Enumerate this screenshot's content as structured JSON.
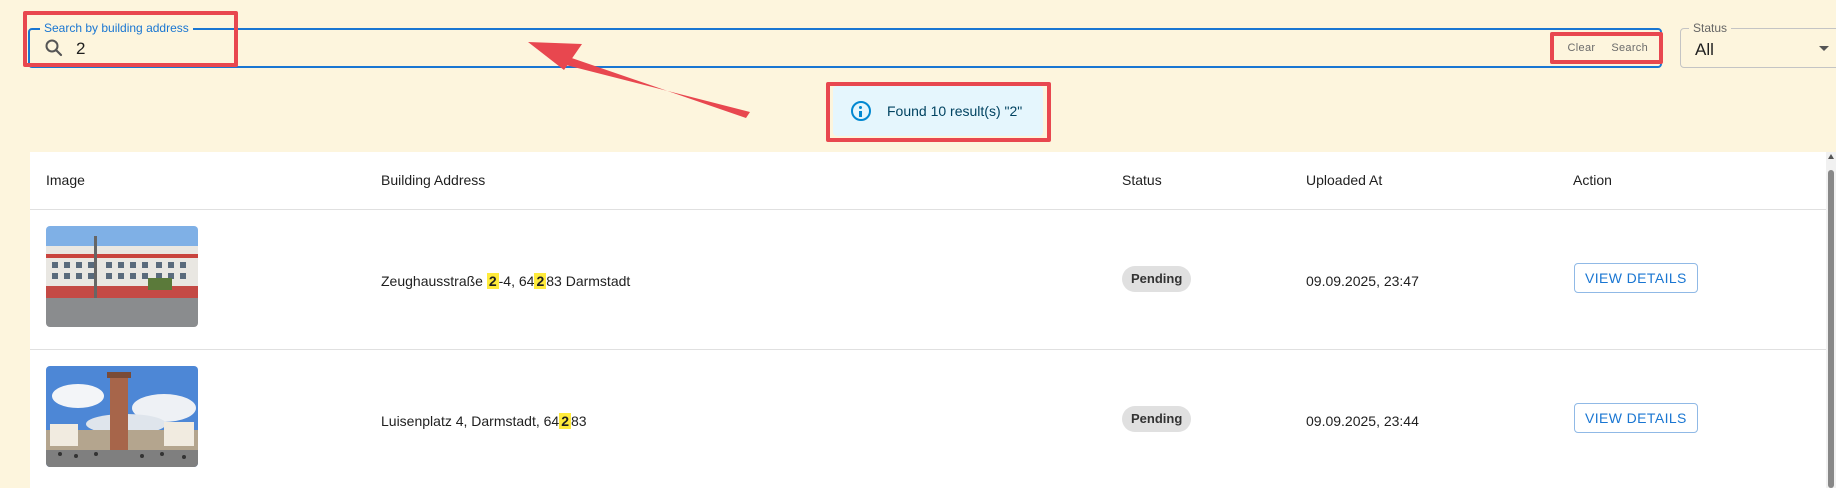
{
  "search": {
    "label": "Search by building address",
    "value": "2",
    "clear_label": "Clear",
    "search_label": "Search"
  },
  "status_filter": {
    "label": "Status",
    "value": "All"
  },
  "alert": {
    "text": "Found 10 result(s) \"2\""
  },
  "table": {
    "columns": [
      "Image",
      "Building Address",
      "Status",
      "Uploaded At",
      "Action"
    ],
    "rows": [
      {
        "address_parts": [
          "Zeughausstraße ",
          "2",
          "-4, 64",
          "2",
          "83 Darmstadt"
        ],
        "status": "Pending",
        "uploaded_at": "09.09.2025, 23:47",
        "action": "VIEW DETAILS"
      },
      {
        "address_parts": [
          "Luisenplatz 4, Darmstadt, 64",
          "2",
          "83"
        ],
        "status": "Pending",
        "uploaded_at": "09.09.2025, 23:44",
        "action": "VIEW DETAILS"
      }
    ]
  },
  "colors": {
    "background": "#fdf5dd",
    "accent": "#1976d2",
    "annotation": "#e8474f",
    "highlight": "#ffeb3b",
    "alert_bg": "#e5f6fd"
  }
}
